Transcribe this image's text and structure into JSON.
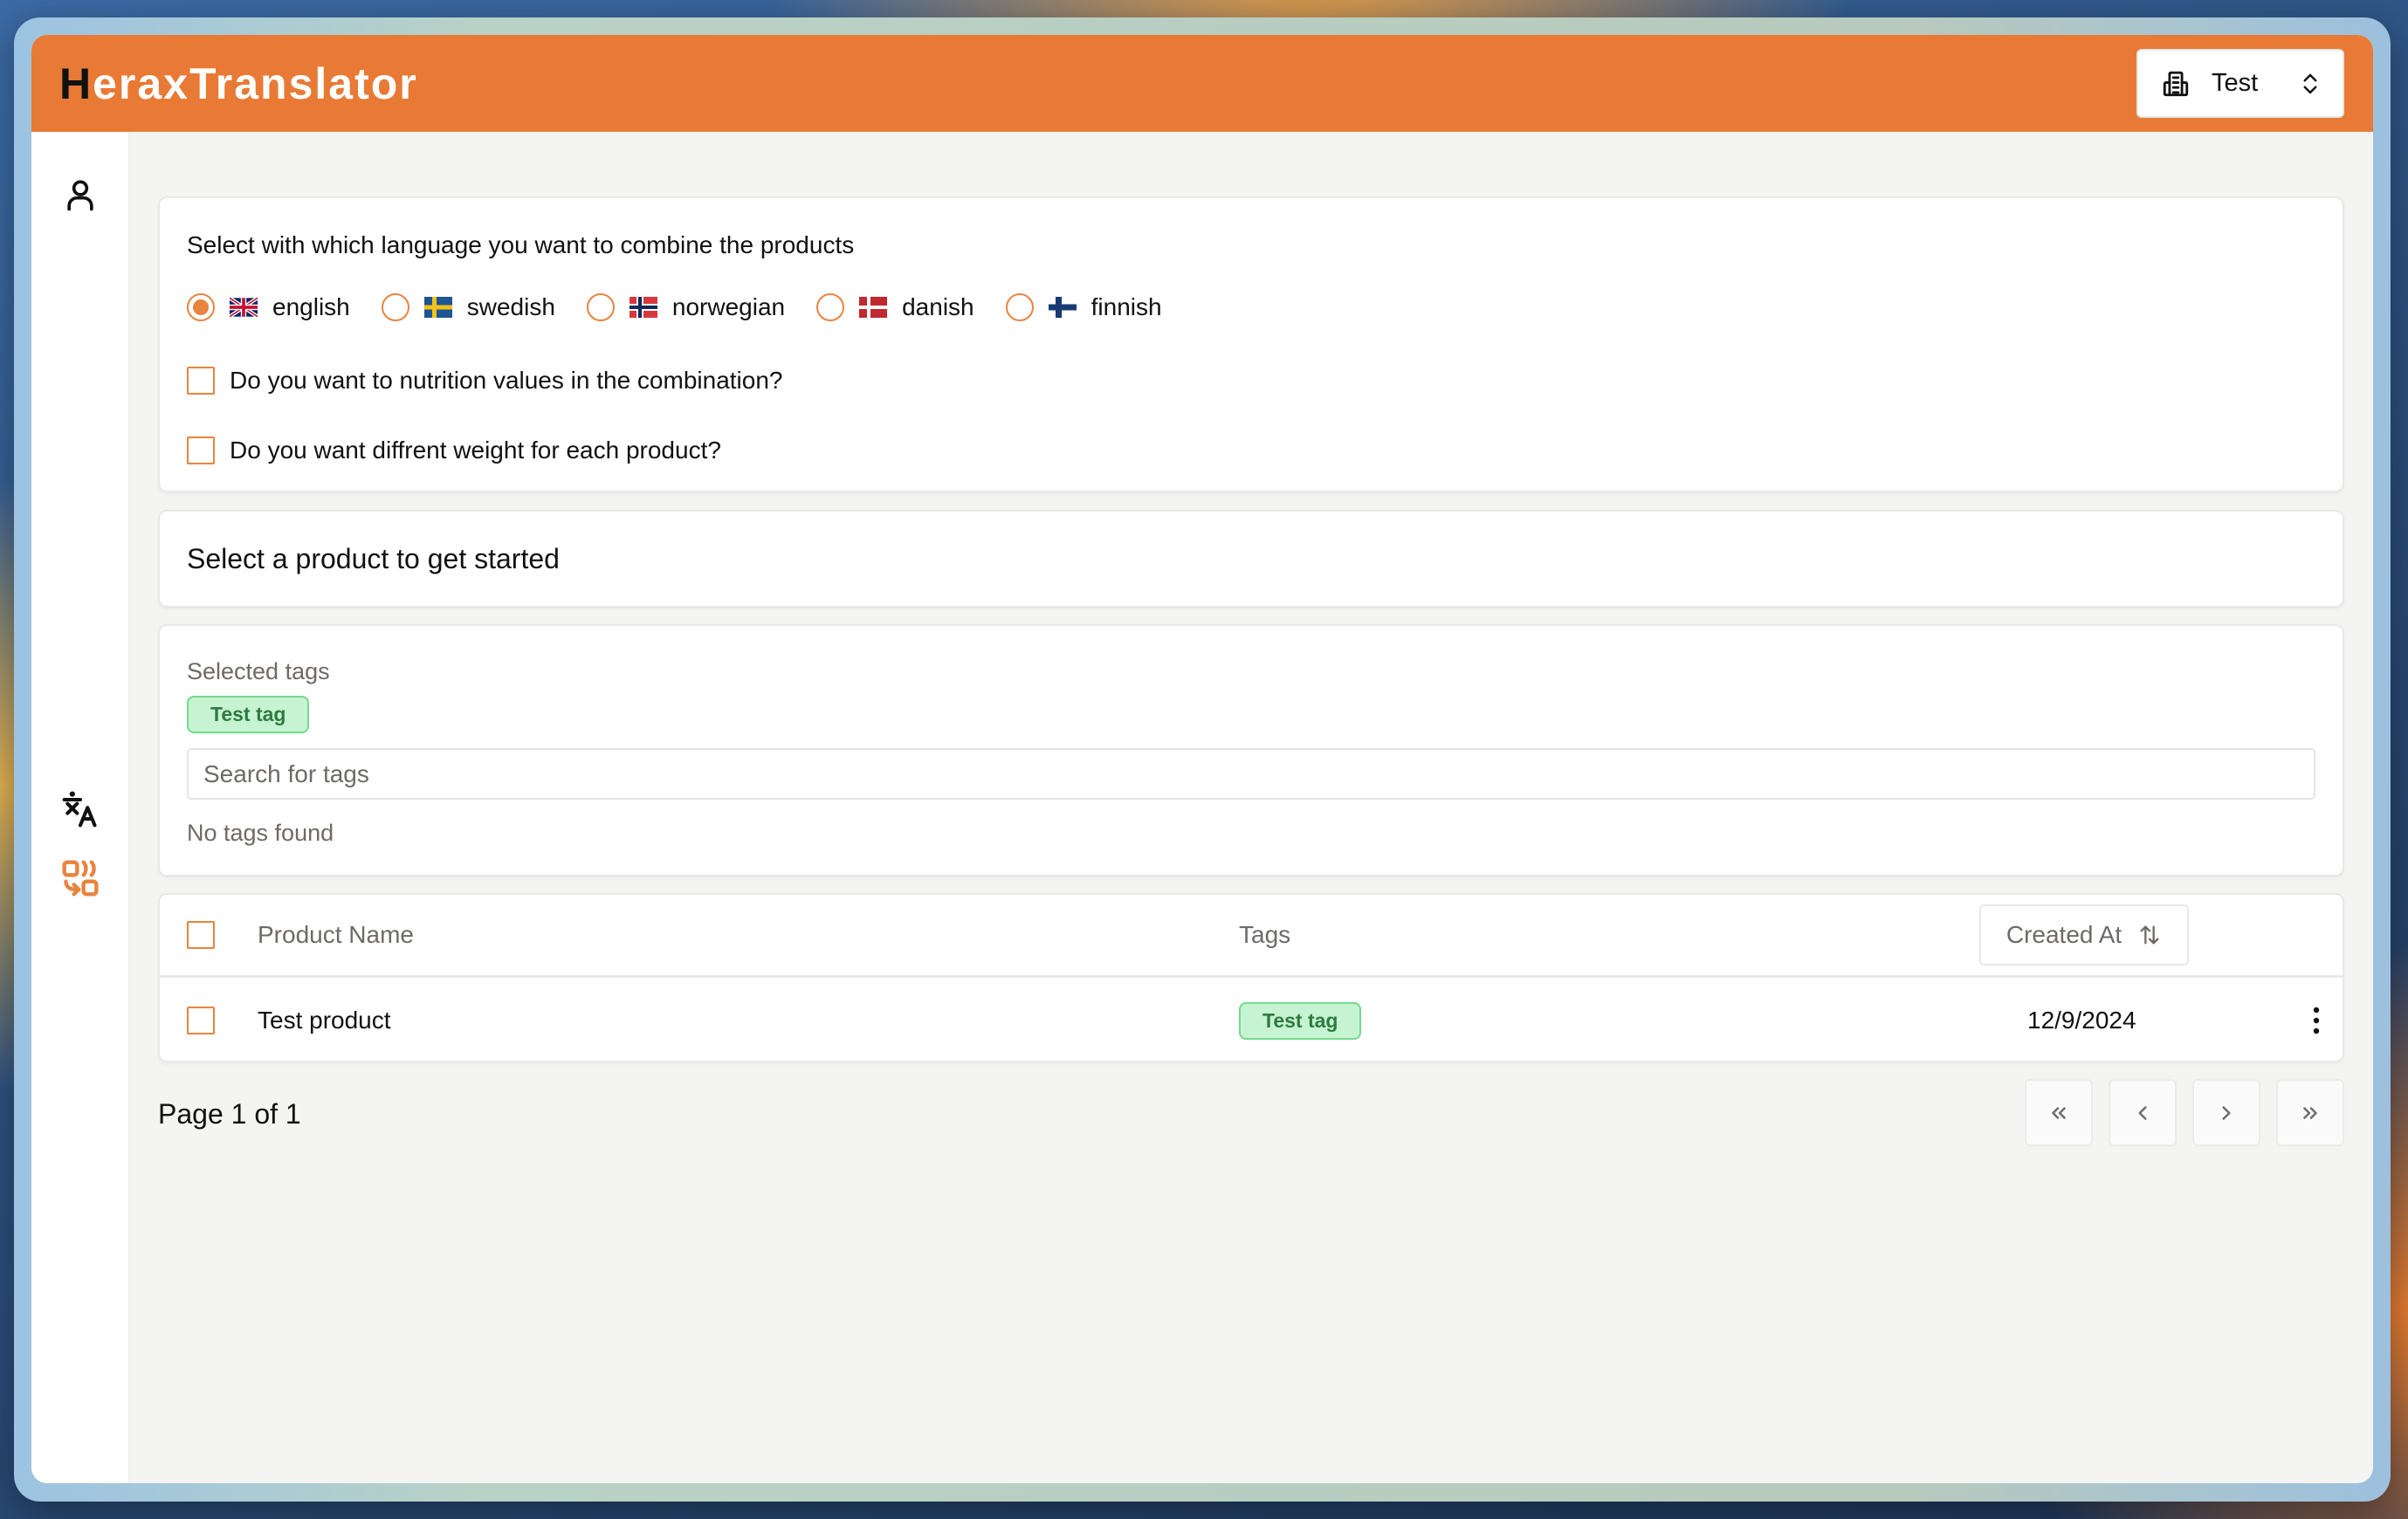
{
  "app": {
    "logo_mark": "H",
    "logo_text": "eraxTranslator",
    "accent_color": "#e87a35"
  },
  "header": {
    "org_select": {
      "icon": "building-icon",
      "value": "Test",
      "indicator": "chevron-up-down-icon"
    }
  },
  "sidebar": {
    "items": [
      {
        "name": "profile",
        "icon": "user-icon"
      },
      {
        "name": "translate",
        "icon": "translate-icon"
      },
      {
        "name": "combine",
        "icon": "combine-icon",
        "active": true
      }
    ]
  },
  "language_card": {
    "title": "Select with which language you want to combine the products",
    "languages": [
      {
        "label": "english",
        "flag": "uk-flag",
        "selected": true
      },
      {
        "label": "swedish",
        "flag": "sweden-flag",
        "selected": false
      },
      {
        "label": "norwegian",
        "flag": "norway-flag",
        "selected": false
      },
      {
        "label": "danish",
        "flag": "denmark-flag",
        "selected": false
      },
      {
        "label": "finnish",
        "flag": "finland-flag",
        "selected": false
      }
    ],
    "options": [
      {
        "label": "Do you want to nutrition values in the combination?",
        "checked": false
      },
      {
        "label": "Do you want diffrent weight for each product?",
        "checked": false
      }
    ]
  },
  "product_card": {
    "message": "Select a product to get started"
  },
  "tags_card": {
    "label": "Selected tags",
    "selected_tags": [
      "Test tag"
    ],
    "search_placeholder": "Search for tags",
    "search_value": "",
    "empty_message": "No tags found"
  },
  "table": {
    "columns": {
      "name": "Product Name",
      "tags": "Tags",
      "created": "Created At"
    },
    "rows": [
      {
        "name": "Test product",
        "tags": [
          "Test tag"
        ],
        "created": "12/9/2024",
        "checked": false
      }
    ]
  },
  "pagination": {
    "info": "Page 1 of 1",
    "buttons": [
      "first-page",
      "previous-page",
      "next-page",
      "last-page"
    ]
  }
}
